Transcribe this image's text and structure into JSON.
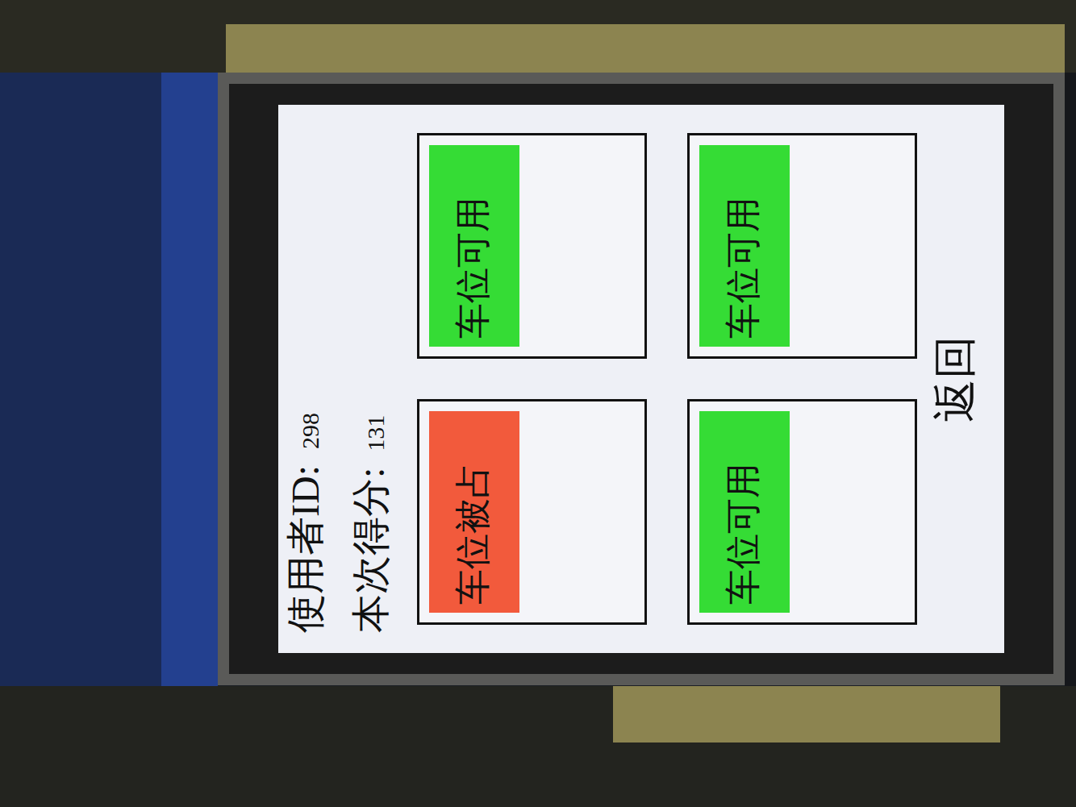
{
  "screen": {
    "header": [
      {
        "label": "使用者ID:",
        "value": "298"
      },
      {
        "label": "本次得分:",
        "value": "131"
      }
    ],
    "spaces": [
      {
        "status": "车位被占",
        "occupied": true,
        "color": "#f25a3c"
      },
      {
        "status": "车位可用",
        "occupied": false,
        "color": "#35dc35"
      },
      {
        "status": "车位可用",
        "occupied": false,
        "color": "#35dc35"
      },
      {
        "status": "车位可用",
        "occupied": false,
        "color": "#35dc35"
      }
    ],
    "buttons": [
      "返回"
    ]
  }
}
